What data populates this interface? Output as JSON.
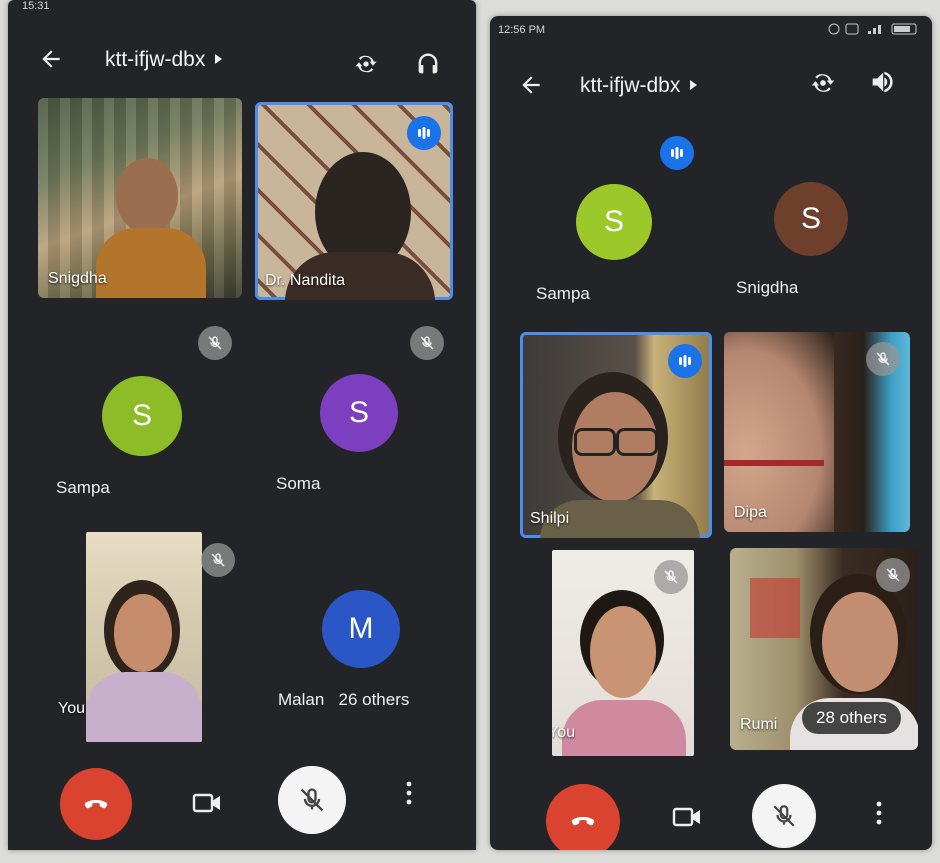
{
  "left": {
    "status_time": "15:31",
    "meeting_code": "ktt-ifjw-dbx",
    "participants": {
      "snigdha": "Snigdha",
      "nandita": "Dr. Nandita",
      "sampa": "Sampa",
      "soma": "Soma",
      "you": "You",
      "malan": "Malan",
      "others": "26 others"
    },
    "avatar_letters": {
      "sampa": "S",
      "soma": "S",
      "malan": "M"
    },
    "colors": {
      "sampa": "#8cbd28",
      "soma": "#7b3fbf",
      "malan": "#2a56c6"
    }
  },
  "right": {
    "status_time": "12:56 PM",
    "meeting_code": "ktt-ifjw-dbx",
    "participants": {
      "sampa": "Sampa",
      "snigdha": "Snigdha",
      "shilpi": "Shilpi",
      "dipa": "Dipa",
      "you": "You",
      "rumi": "Rumi",
      "others": "28 others"
    },
    "avatar_letters": {
      "sampa": "S",
      "snigdha": "S"
    },
    "colors": {
      "sampa": "#9cc82a",
      "snigdha": "#6e3f2a"
    }
  },
  "icons": {
    "back": "arrow-left-icon",
    "switch_camera": "switch-camera-icon",
    "audio_headset": "headset-icon",
    "speaker": "speaker-icon",
    "end_call": "end-call-icon",
    "video": "video-icon",
    "mic_off": "mic-off-icon",
    "more": "more-vertical-icon"
  }
}
